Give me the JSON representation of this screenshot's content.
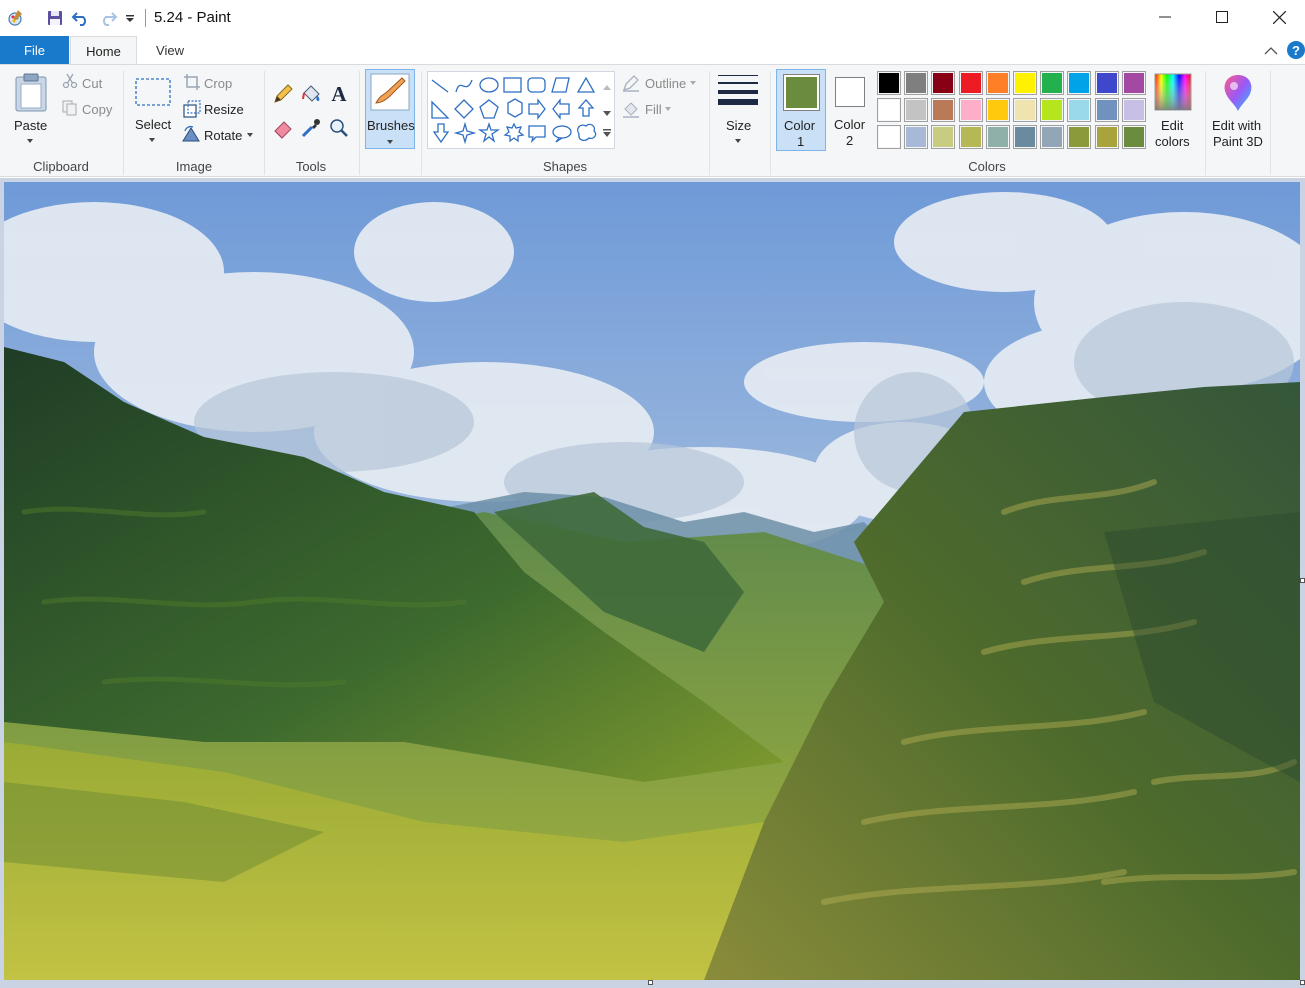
{
  "window": {
    "title": "5.24 - Paint",
    "controls": [
      "minimize",
      "maximize",
      "close"
    ]
  },
  "quick_access": {
    "icons": [
      "paint-app-icon",
      "save-icon",
      "undo-icon",
      "redo-icon",
      "customize-dropdown-icon"
    ]
  },
  "tabs": {
    "file": "File",
    "home": "Home",
    "view": "View"
  },
  "ribbon": {
    "clipboard": {
      "group_label": "Clipboard",
      "paste": "Paste",
      "cut": "Cut",
      "copy": "Copy"
    },
    "image": {
      "group_label": "Image",
      "select": "Select",
      "crop": "Crop",
      "resize": "Resize",
      "rotate": "Rotate"
    },
    "tools": {
      "group_label": "Tools",
      "items": [
        "pencil-icon",
        "fill-bucket-icon",
        "text-icon",
        "eraser-icon",
        "color-picker-icon",
        "magnifier-icon"
      ]
    },
    "brushes": {
      "label": "Brushes"
    },
    "shapes": {
      "group_label": "Shapes",
      "outline": "Outline",
      "fill": "Fill"
    },
    "size": {
      "label": "Size"
    },
    "colors": {
      "group_label": "Colors",
      "color1_label_a": "Color",
      "color1_label_b": "1",
      "color2_label_a": "Color",
      "color2_label_b": "2",
      "color1": "#6b8c3e",
      "color2": "#ffffff",
      "edit_colors_a": "Edit",
      "edit_colors_b": "colors",
      "edit_paint3d_a": "Edit with",
      "edit_paint3d_b": "Paint 3D",
      "palette": [
        [
          "#000000",
          "#7f7f7f",
          "#880015",
          "#ed1c24",
          "#ff7f27",
          "#fff200",
          "#22b14c",
          "#00a2e8",
          "#3f48cc",
          "#a349a4"
        ],
        [
          "#ffffff",
          "#c3c3c3",
          "#b97a57",
          "#ffaec9",
          "#ffc90e",
          "#efe4b0",
          "#b5e61d",
          "#99d9ea",
          "#7092be",
          "#c8bfe7"
        ],
        [
          "#ffffff",
          "#a7b9d7",
          "#c8cc80",
          "#b6b855",
          "#8fb0a8",
          "#6a8aa0",
          "#93a6b7",
          "#8b9a3a",
          "#a8a33a",
          "#6b8c3e"
        ]
      ]
    }
  },
  "accent": "#1979ca"
}
